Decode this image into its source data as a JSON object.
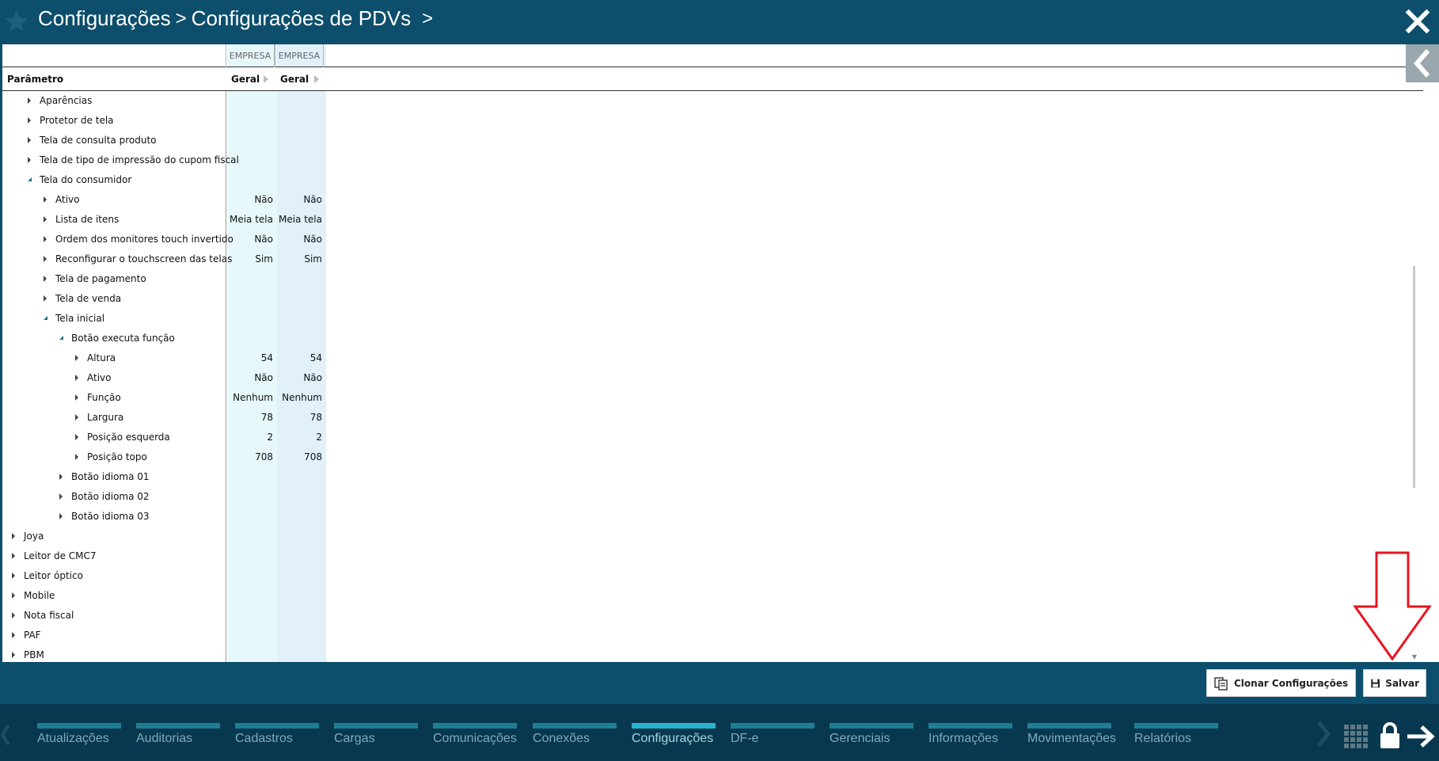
{
  "header": {
    "breadcrumbs": [
      "Configurações",
      "Configurações de PDVs"
    ],
    "background": "#0c4e6b"
  },
  "grid": {
    "column_groups": [
      "EMPRESA",
      "EMPRESA"
    ],
    "param_header": "Parâmetro",
    "columns": [
      "Geral",
      "Geral"
    ],
    "rows": [
      {
        "label": "Aparências",
        "level": 1,
        "state": "collapsed",
        "values": [
          "",
          ""
        ]
      },
      {
        "label": "Protetor de tela",
        "level": 1,
        "state": "collapsed",
        "values": [
          "",
          ""
        ]
      },
      {
        "label": "Tela de consulta produto",
        "level": 1,
        "state": "collapsed",
        "values": [
          "",
          ""
        ]
      },
      {
        "label": "Tela de tipo de impressão do cupom fiscal",
        "level": 1,
        "state": "collapsed",
        "values": [
          "",
          ""
        ]
      },
      {
        "label": "Tela do consumidor",
        "level": 1,
        "state": "expanded",
        "values": [
          "",
          ""
        ]
      },
      {
        "label": "Ativo",
        "level": 2,
        "state": "collapsed",
        "values": [
          "Não",
          "Não"
        ]
      },
      {
        "label": "Lista de itens",
        "level": 2,
        "state": "collapsed",
        "values": [
          "Meia tela",
          "Meia tela"
        ]
      },
      {
        "label": "Ordem dos monitores touch invertido",
        "level": 2,
        "state": "collapsed",
        "values": [
          "Não",
          "Não"
        ]
      },
      {
        "label": "Reconfigurar o touchscreen das telas",
        "level": 2,
        "state": "collapsed",
        "values": [
          "Sim",
          "Sim"
        ]
      },
      {
        "label": "Tela de pagamento",
        "level": 2,
        "state": "collapsed",
        "values": [
          "",
          ""
        ]
      },
      {
        "label": "Tela de venda",
        "level": 2,
        "state": "collapsed",
        "values": [
          "",
          ""
        ]
      },
      {
        "label": "Tela inicial",
        "level": 2,
        "state": "expanded",
        "values": [
          "",
          ""
        ]
      },
      {
        "label": "Botão executa função",
        "level": 3,
        "state": "expanded",
        "values": [
          "",
          ""
        ]
      },
      {
        "label": "Altura",
        "level": 4,
        "state": "collapsed",
        "values": [
          "54",
          "54"
        ]
      },
      {
        "label": "Ativo",
        "level": 4,
        "state": "collapsed",
        "values": [
          "Não",
          "Não"
        ]
      },
      {
        "label": "Função",
        "level": 4,
        "state": "collapsed",
        "values": [
          "Nenhum",
          "Nenhum"
        ]
      },
      {
        "label": "Largura",
        "level": 4,
        "state": "collapsed",
        "values": [
          "78",
          "78"
        ]
      },
      {
        "label": "Posição esquerda",
        "level": 4,
        "state": "collapsed",
        "values": [
          "2",
          "2"
        ]
      },
      {
        "label": "Posição topo",
        "level": 4,
        "state": "collapsed",
        "values": [
          "708",
          "708"
        ]
      },
      {
        "label": "Botão idioma 01",
        "level": 3,
        "state": "collapsed",
        "values": [
          "",
          ""
        ]
      },
      {
        "label": "Botão idioma 02",
        "level": 3,
        "state": "collapsed",
        "values": [
          "",
          ""
        ]
      },
      {
        "label": "Botão idioma 03",
        "level": 3,
        "state": "collapsed",
        "values": [
          "",
          ""
        ]
      },
      {
        "label": "Joya",
        "level": 0,
        "state": "collapsed",
        "values": [
          "",
          ""
        ]
      },
      {
        "label": "Leitor de CMC7",
        "level": 0,
        "state": "collapsed",
        "values": [
          "",
          ""
        ]
      },
      {
        "label": "Leitor óptico",
        "level": 0,
        "state": "collapsed",
        "values": [
          "",
          ""
        ]
      },
      {
        "label": "Mobile",
        "level": 0,
        "state": "collapsed",
        "values": [
          "",
          ""
        ]
      },
      {
        "label": "Nota fiscal",
        "level": 0,
        "state": "collapsed",
        "values": [
          "",
          ""
        ]
      },
      {
        "label": "PAF",
        "level": 0,
        "state": "collapsed",
        "values": [
          "",
          ""
        ]
      },
      {
        "label": "PBM",
        "level": 0,
        "state": "collapsed",
        "values": [
          "",
          ""
        ]
      }
    ]
  },
  "actions": {
    "clone_label": "Clonar Configurações",
    "save_label": "Salvar"
  },
  "bottom_nav": {
    "items": [
      {
        "label": "Atualizações",
        "active": false
      },
      {
        "label": "Auditorias",
        "active": false
      },
      {
        "label": "Cadastros",
        "active": false
      },
      {
        "label": "Cargas",
        "active": false
      },
      {
        "label": "Comunicações",
        "active": false
      },
      {
        "label": "Conexões",
        "active": false
      },
      {
        "label": "Configurações",
        "active": true
      },
      {
        "label": "DF-e",
        "active": false
      },
      {
        "label": "Gerenciais",
        "active": false
      },
      {
        "label": "Informações",
        "active": false
      },
      {
        "label": "Movimentações",
        "active": false
      },
      {
        "label": "Relatórios",
        "active": false
      }
    ]
  },
  "colors": {
    "header": "#0c4e6b",
    "nav_bg": "#08384f",
    "nav_bar": "#1f7e93",
    "nav_bar_active": "#27b4cc",
    "col1_bg": "#e6f8fa",
    "col2_bg": "#e2f0fa",
    "annotation_arrow": "#e8141e"
  },
  "icons": {
    "header_left": "star-icon",
    "header_right": "close-icon",
    "clone": "clone-icon",
    "save": "floppy-disk-icon",
    "nav_right": "chevron-right-icon",
    "apps": "grid-icon",
    "lock": "lock-icon",
    "exit": "exit-arrow-icon"
  }
}
